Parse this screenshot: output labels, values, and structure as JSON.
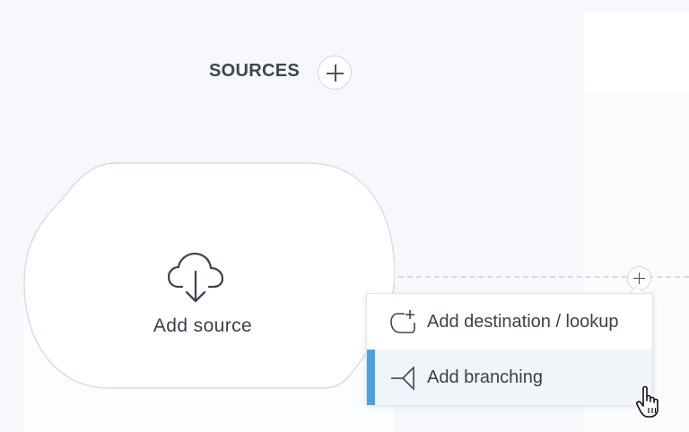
{
  "sources": {
    "title": "SOURCES",
    "add_button_icon": "plus-icon"
  },
  "source_node": {
    "icon": "cloud-download-icon",
    "label": "Add source"
  },
  "connector": {
    "add_icon": "plus-icon"
  },
  "menu": {
    "items": [
      {
        "icon": "destination-add-icon",
        "label": "Add destination / lookup"
      },
      {
        "icon": "branching-icon",
        "label": "Add branching",
        "highlighted": true
      }
    ]
  },
  "colors": {
    "accent": "#4aa3df",
    "text": "#3a414c",
    "background": "#f6f8fc"
  }
}
